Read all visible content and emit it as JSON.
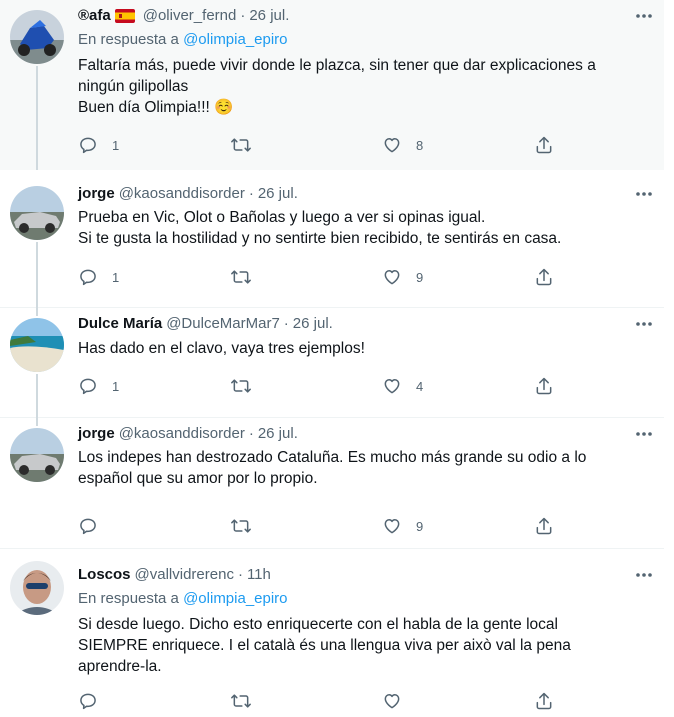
{
  "tweets": [
    {
      "name": "®afa",
      "has_flag": true,
      "handle": "@oliver_fernd",
      "dot": "·",
      "time": "26 jul.",
      "reply_prefix": "En respuesta a",
      "reply_to": "@olimpia_epiro",
      "lines": [
        "Faltaría más, puede vivir donde le plazca, sin tener que dar explicaciones a",
        "ningún gilipollas",
        "Buen día Olimpia!!! ☺️"
      ],
      "replies": "1",
      "retweets": "",
      "likes": "8"
    },
    {
      "name": "jorge",
      "handle": "@kaosanddisorder",
      "dot": "·",
      "time": "26 jul.",
      "lines": [
        "Prueba en Vic, Olot o Bañolas y luego a ver si opinas igual.",
        "Si te gusta la hostilidad y no sentirte bien recibido, te sentirás en casa."
      ],
      "replies": "1",
      "retweets": "",
      "likes": "9"
    },
    {
      "name": "Dulce María",
      "handle": "@DulceMarMar7",
      "dot": "·",
      "time": "26 jul.",
      "lines": [
        "Has dado en el clavo, vaya tres ejemplos!"
      ],
      "replies": "1",
      "retweets": "",
      "likes": "4"
    },
    {
      "name": "jorge",
      "handle": "@kaosanddisorder",
      "dot": "·",
      "time": "26 jul.",
      "lines": [
        "Los indepes han destrozado Cataluña. Es mucho más grande su odio a lo",
        "español que su amor por lo propio."
      ],
      "replies": "",
      "retweets": "",
      "likes": "9"
    },
    {
      "name": "Loscos",
      "handle": "@vallvidrerenc",
      "dot": "·",
      "time": "11h",
      "reply_prefix": "En respuesta a",
      "reply_to": "@olimpia_epiro",
      "lines": [
        "Si desde luego. Dicho esto enriquecerte con el habla de la gente local",
        "SIEMPRE enriquece. I el català és una llengua viva per això val la pena",
        "aprendre-la."
      ],
      "replies": "",
      "retweets": "",
      "likes": ""
    }
  ],
  "icons": {
    "reply": "reply-icon",
    "retweet": "retweet-icon",
    "like": "heart-icon",
    "share": "share-icon",
    "more": "more-icon"
  },
  "colors": {
    "link": "#1d9bf0",
    "secondary": "#536471",
    "thread_line": "#cfd9de",
    "highlight_bg": "#f7f9f9"
  }
}
